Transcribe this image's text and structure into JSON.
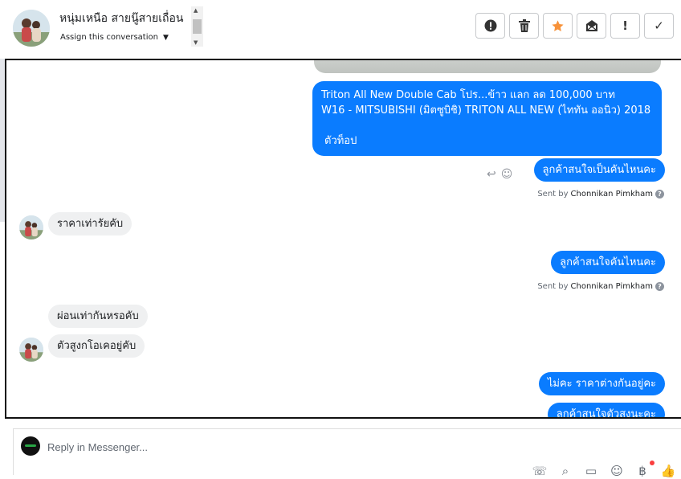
{
  "header": {
    "contact_name": "หนุ่มเหนือ สายนู๊สายเถื่อน",
    "assign_label": "Assign this conversation",
    "actions": [
      {
        "name": "spam-button",
        "icon": "alert-circle-icon",
        "glyph": ""
      },
      {
        "name": "delete-button",
        "icon": "trash-icon",
        "glyph": ""
      },
      {
        "name": "star-button",
        "icon": "star-icon",
        "glyph": ""
      },
      {
        "name": "mark-unread-button",
        "icon": "mail-icon",
        "glyph": ""
      },
      {
        "name": "important-button",
        "icon": "exclamation-icon",
        "glyph": "!"
      },
      {
        "name": "mark-done-button",
        "icon": "check-icon",
        "glyph": "✓"
      }
    ]
  },
  "colors": {
    "outgoing_bubble": "#0a7cff",
    "incoming_bubble": "#eff0f1",
    "star": "#f7923a"
  },
  "messages": {
    "m1_line1": "Triton All New Double Cab โปร...ข้าว แลก ลด 100,000 บาท",
    "m1_line2": "W16 - MITSUBISHI (มิตซูบิชิ) TRITON ALL NEW (ไททัน ออนิว) 2018",
    "m1_line3": "ตัวท็อป",
    "m2": "ลูกค้าสนใจเป็นคันไหนคะ",
    "m3": "ราคาเท่ารัยคับ",
    "m4": "ลูกค้าสนใจคันไหนคะ",
    "m5": "ผ่อนเท่ากันหรอคับ",
    "m6": "ตัวสูงกโอเคอยู่คับ",
    "m7": "ไม่คะ ราคาต่างกันอยู่คะ",
    "m8": "ลูกค้าสนใจตัวสงนะคะ"
  },
  "sent_by": {
    "prefix": "Sent by",
    "agent": "Chonnikan Pimkham"
  },
  "composer": {
    "placeholder": "Reply in Messenger..."
  }
}
